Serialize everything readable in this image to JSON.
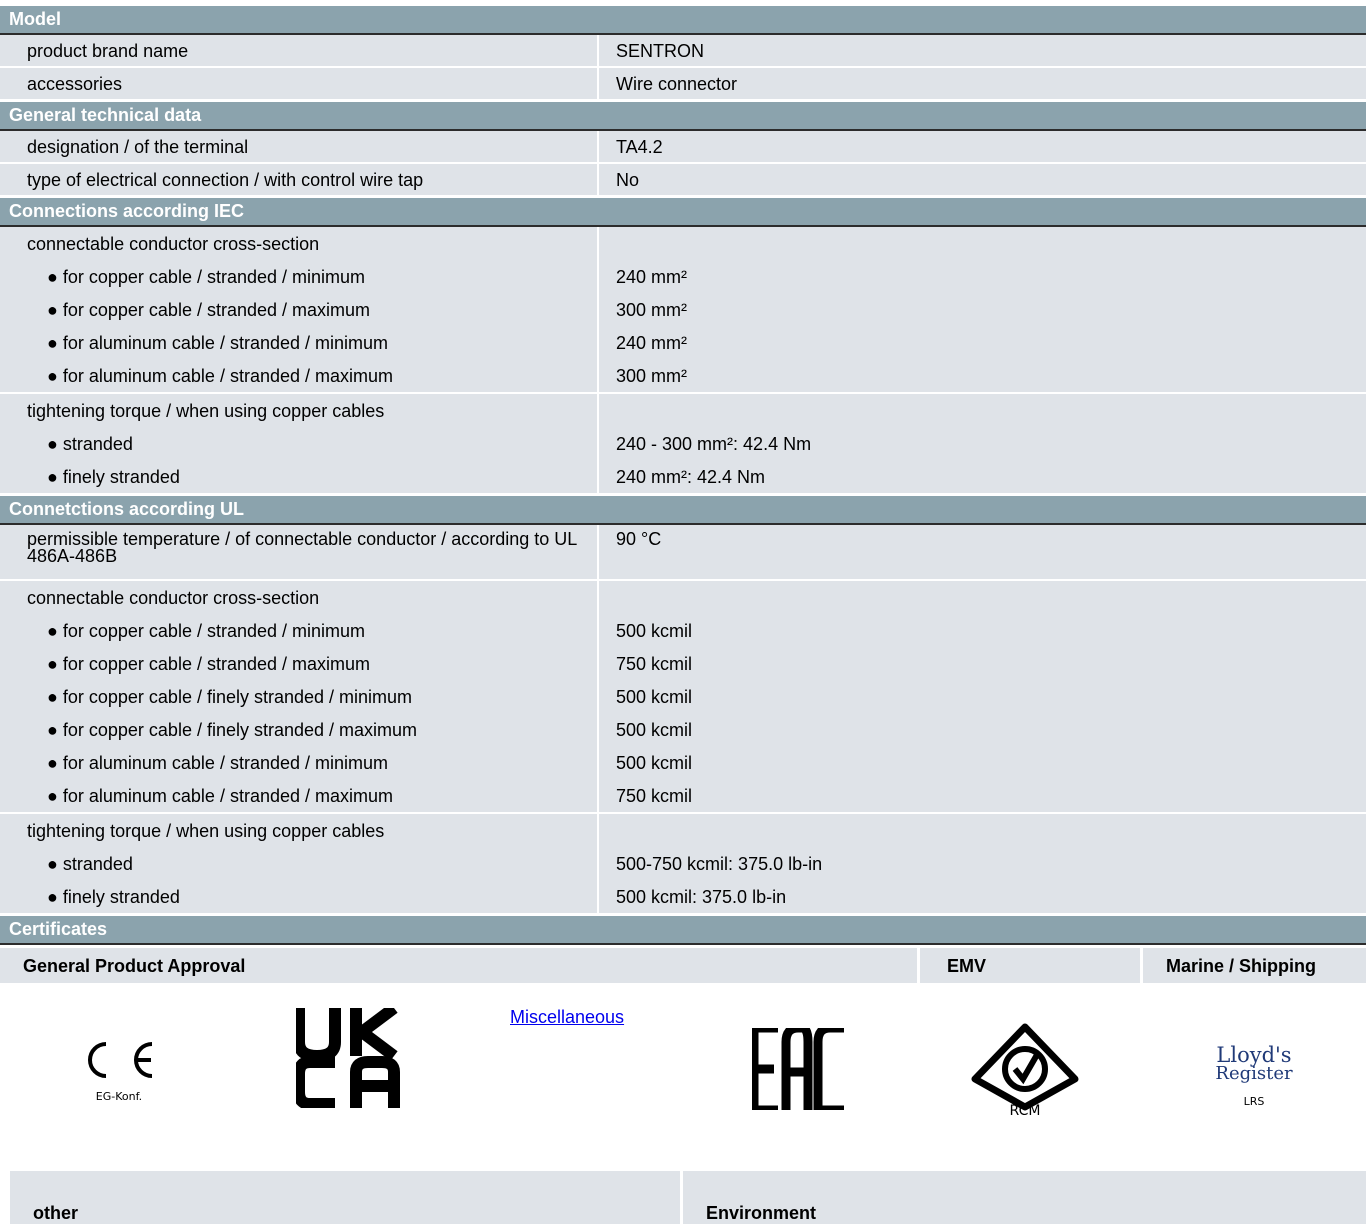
{
  "sections": {
    "model": {
      "title": "Model",
      "rows": [
        {
          "label": "product brand name",
          "value": "SENTRON"
        },
        {
          "label": "accessories",
          "value": "Wire connector"
        }
      ]
    },
    "general": {
      "title": "General technical data",
      "rows": [
        {
          "label": "designation / of the terminal",
          "value": "TA4.2"
        },
        {
          "label": "type of electrical connection / with control wire tap",
          "value": "No"
        }
      ]
    },
    "iec": {
      "title": "Connections according IEC",
      "cross_section": {
        "label": "connectable conductor cross-section",
        "items": [
          {
            "label": "● for copper cable / stranded / minimum",
            "value": "240 mm²"
          },
          {
            "label": "● for copper cable / stranded / maximum",
            "value": "300 mm²"
          },
          {
            "label": "● for aluminum cable / stranded / minimum",
            "value": "240 mm²"
          },
          {
            "label": "● for aluminum cable / stranded / maximum",
            "value": "300 mm²"
          }
        ]
      },
      "torque": {
        "label": "tightening torque / when using copper cables",
        "items": [
          {
            "label": "● stranded",
            "value": "240 - 300 mm²: 42.4 Nm"
          },
          {
            "label": "● finely stranded",
            "value": "240 mm²: 42.4 Nm"
          }
        ]
      }
    },
    "ul": {
      "title": "Connetctions according UL",
      "temperature": {
        "label": "permissible temperature / of connectable conductor / according to UL 486A-486B",
        "value": "90 °C"
      },
      "cross_section": {
        "label": "connectable conductor cross-section",
        "items": [
          {
            "label": "● for copper cable / stranded / minimum",
            "value": "500 kcmil"
          },
          {
            "label": "● for copper cable / stranded / maximum",
            "value": "750 kcmil"
          },
          {
            "label": "● for copper cable / finely stranded / minimum",
            "value": "500 kcmil"
          },
          {
            "label": "● for copper cable / finely stranded / maximum",
            "value": "500 kcmil"
          },
          {
            "label": "● for aluminum cable / stranded / minimum",
            "value": "500 kcmil"
          },
          {
            "label": "● for aluminum cable / stranded / maximum",
            "value": "750 kcmil"
          }
        ]
      },
      "torque": {
        "label": "tightening torque / when using copper cables",
        "items": [
          {
            "label": "● stranded",
            "value": "500-750 kcmil: 375.0 lb-in"
          },
          {
            "label": "● finely stranded",
            "value": "500 kcmil: 375.0 lb-in"
          }
        ]
      }
    },
    "certificates": {
      "title": "Certificates",
      "headers": {
        "general": "General Product Approval",
        "emv": "EMV",
        "marine": "Marine / Shipping"
      },
      "misc_link": "Miscellaneous",
      "logos": {
        "ce_caption": "EG-Konf.",
        "rcm_caption": "RCM",
        "lloyds_line1": "Lloyd's",
        "lloyds_line2": "Register",
        "lloyds_caption": "LRS"
      },
      "bottom_headers": {
        "other": "other",
        "environment": "Environment"
      }
    }
  },
  "colors": {
    "section_header": "#8ba3ad",
    "row_background": "#dfe3e8",
    "link": "#0000ee"
  },
  "icons": [
    "ce-mark-icon",
    "ukca-mark-icon",
    "eac-mark-icon",
    "rcm-mark-icon",
    "lloyds-register-icon"
  ]
}
